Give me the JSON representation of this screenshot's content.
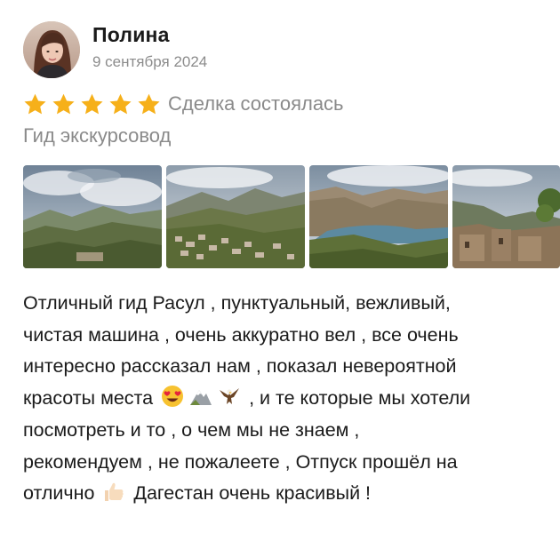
{
  "author": {
    "name": "Полина",
    "date": "9 сентября 2024"
  },
  "rating": {
    "stars": 5,
    "max": 5,
    "star_color": "#f6b01a",
    "deal_status": "Сделка состоялась"
  },
  "service_category": "Гид экскурсовод",
  "photos": [
    {
      "icon": "mountain-panorama-photo"
    },
    {
      "icon": "mountain-village-photo"
    },
    {
      "icon": "canyon-reservoir-photo"
    },
    {
      "icon": "mountain-ruins-photo"
    }
  ],
  "review": {
    "line1": "Отличный гид Расул  , пунктуальный, вежливый,",
    "line2": "чистая машина , очень аккуратно вел , все очень",
    "line3": "интересно рассказал нам , показал невероятной",
    "line4_part1": "красоты  места",
    "line4_part2": " , и те которые мы хотели",
    "line5": "посмотреть и то , о чем мы не знаем ,",
    "line6": "рекомендуем , не пожалеете , Отпуск прошёл на",
    "line7_part1": "отлично",
    "line7_part2": " Дагестан очень красивый !",
    "emojis": [
      "heart-eyes-emoji",
      "mountain-emoji",
      "eagle-emoji",
      "thumbs-up-emoji"
    ]
  }
}
